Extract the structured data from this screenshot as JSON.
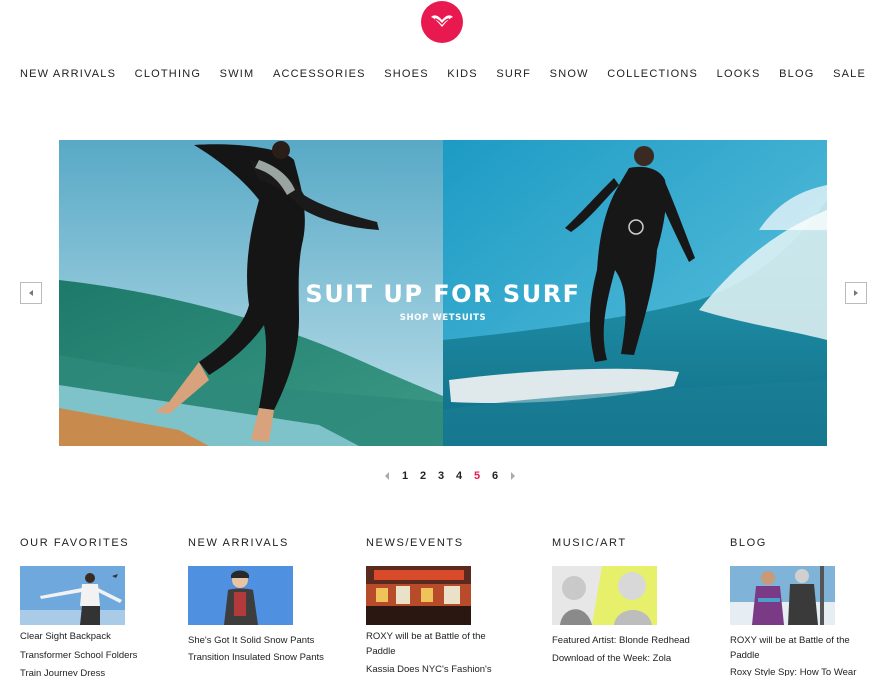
{
  "brand": {
    "accent": "#e8194f"
  },
  "nav": {
    "items": [
      "NEW ARRIVALS",
      "CLOTHING",
      "SWIM",
      "ACCESSORIES",
      "SHOES",
      "KIDS",
      "SURF",
      "SNOW",
      "COLLECTIONS",
      "LOOKS",
      "BLOG",
      "SALE"
    ]
  },
  "hero": {
    "title": "SUIT UP FOR SURF",
    "subtitle": "SHOP WETSUITS"
  },
  "pager": {
    "pages": [
      "1",
      "2",
      "3",
      "4",
      "5",
      "6"
    ],
    "active": "5"
  },
  "sections": {
    "favorites": {
      "title": "OUR FAVORITES",
      "links": [
        "Clear Sight Backpack",
        "Transformer School Folders",
        "Train Journey Dress"
      ]
    },
    "arrivals": {
      "title": "NEW ARRIVALS",
      "links": [
        "She's Got It Solid Snow Pants",
        "Transition Insulated Snow Pants"
      ]
    },
    "news": {
      "title": "NEWS/EVENTS",
      "links": [
        "ROXY will be at Battle of the Paddle",
        "Kassia Does NYC's Fashion's"
      ]
    },
    "music": {
      "title": "MUSIC/ART",
      "links": [
        "Featured Artist: Blonde Redhead",
        "Download of the Week: Zola"
      ]
    },
    "blog": {
      "title": "BLOG",
      "links": [
        "ROXY will be at Battle of the Paddle",
        "Roxy Style Spy: How To Wear"
      ]
    }
  }
}
